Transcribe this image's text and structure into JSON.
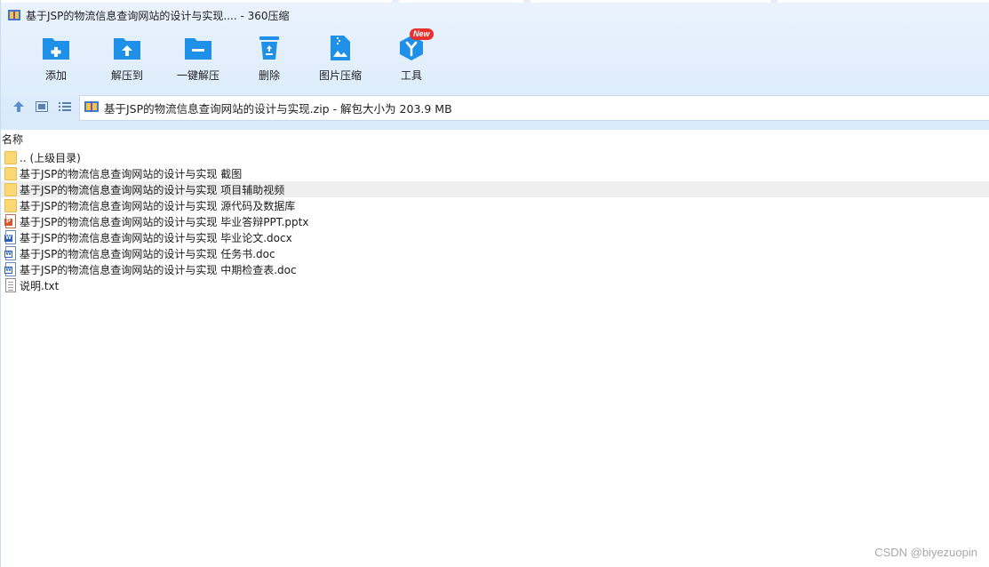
{
  "window": {
    "title": "基于JSP的物流信息查询网站的设计与实现.... - 360压缩"
  },
  "toolbar": {
    "items": [
      {
        "label": "添加",
        "icon": "add-folder-icon"
      },
      {
        "label": "解压到",
        "icon": "extract-to-icon"
      },
      {
        "label": "一键解压",
        "icon": "one-click-extract-icon"
      },
      {
        "label": "删除",
        "icon": "recycle-bin-icon"
      },
      {
        "label": "图片压缩",
        "icon": "image-compress-icon"
      },
      {
        "label": "工具",
        "icon": "tools-icon",
        "badge": "New"
      }
    ]
  },
  "address": {
    "text": "基于JSP的物流信息查询网站的设计与实现.zip - 解包大小为 203.9 MB"
  },
  "columns": {
    "name": "名称"
  },
  "files": [
    {
      "name": ".. (上级目录)",
      "type": "folder"
    },
    {
      "name": "基于JSP的物流信息查询网站的设计与实现 截图",
      "type": "folder"
    },
    {
      "name": "基于JSP的物流信息查询网站的设计与实现 项目辅助视频",
      "type": "folder"
    },
    {
      "name": "基于JSP的物流信息查询网站的设计与实现 源代码及数据库",
      "type": "folder"
    },
    {
      "name": "基于JSP的物流信息查询网站的设计与实现 毕业答辩PPT.pptx",
      "type": "pptx"
    },
    {
      "name": "基于JSP的物流信息查询网站的设计与实现 毕业论文.docx",
      "type": "docx"
    },
    {
      "name": "基于JSP的物流信息查询网站的设计与实现 任务书.doc",
      "type": "doc"
    },
    {
      "name": "基于JSP的物流信息查询网站的设计与实现 中期检查表.doc",
      "type": "doc"
    },
    {
      "name": "说明.txt",
      "type": "txt"
    }
  ],
  "watermark": "CSDN @biyezuopin",
  "colors": {
    "accent": "#1e90e8",
    "badge": "#e8312f",
    "folder": "#fcd874",
    "pptx": "#d9552b",
    "docx": "#2b5fb8"
  }
}
